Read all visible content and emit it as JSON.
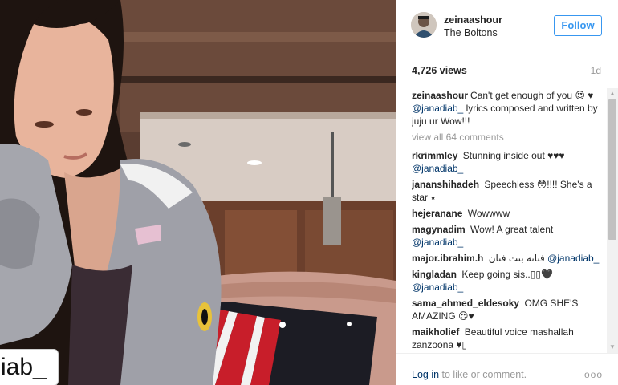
{
  "photo": {
    "tag_text": "iab_"
  },
  "header": {
    "username": "zeinaashour",
    "location": "The Boltons",
    "follow_label": "Follow"
  },
  "stats": {
    "views": "4,726 views",
    "age": "1d"
  },
  "caption": {
    "user": "zeinaashour",
    "text": "Can't get enough of you 😍 ♥ ",
    "mention": "@janadiab_",
    "text_after": " lyrics composed and written by juju ur Wow!!!"
  },
  "view_all": "view all 64 comments",
  "comments": [
    {
      "user": "rkrimmley",
      "text": "Stunning inside out ♥♥♥",
      "mention": "@janadiab_"
    },
    {
      "user": "jananshihadeh",
      "text": "Speechless 😳!!!! She's a star ⭑",
      "mention": ""
    },
    {
      "user": "hejeranane",
      "text": "Wowwww",
      "mention": ""
    },
    {
      "user": "magynadim",
      "text": "Wow! A great talent",
      "mention": "@janadiab_"
    },
    {
      "user": "major.ibrahim.h",
      "text": "فنانه بنت فنان",
      "mention": "@janadiab_"
    },
    {
      "user": "kingladan",
      "text": "Keep going sis..▯▯🖤",
      "mention": "@janadiab_"
    },
    {
      "user": "sama_ahmed_eldesoky",
      "text": "OMG SHE'S AMAZING 😍♥",
      "mention": ""
    },
    {
      "user": "maikholief",
      "text": "Beautiful voice mashallah zanzoona ♥▯",
      "mention": ""
    }
  ],
  "footer": {
    "login_link": "Log in",
    "login_rest": " to like or comment.",
    "more": "ooo"
  },
  "colors": {
    "accent": "#3897f0",
    "mention": "#003569",
    "muted": "#999999",
    "text": "#262626"
  },
  "icons": {
    "scroll_up": "triangle-up",
    "scroll_down": "triangle-down"
  }
}
